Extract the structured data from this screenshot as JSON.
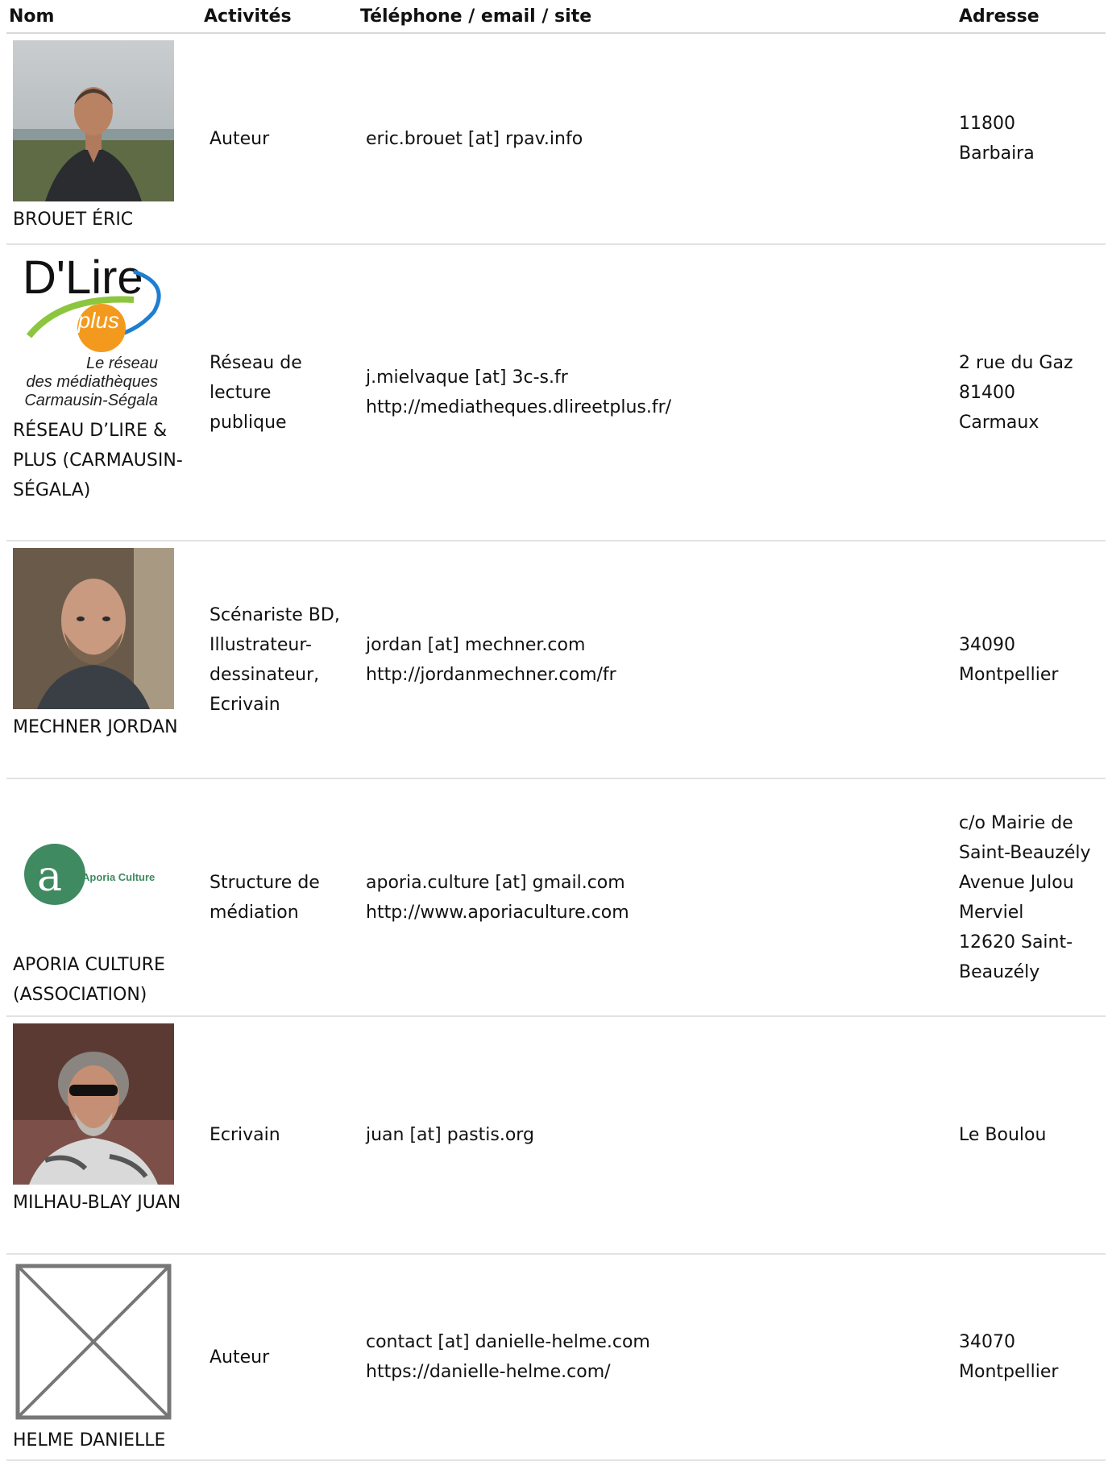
{
  "table": {
    "headers": {
      "name": "Nom",
      "activities": "Activités",
      "contact": "Téléphone / email / site",
      "address": "Adresse"
    },
    "rows": [
      {
        "name": "BROUET ÉRIC",
        "photo_icon": "portrait-photo",
        "activities": "Auteur",
        "contact": [
          "eric.brouet [at] rpav.info"
        ],
        "address": [
          "11800",
          "Barbaira"
        ]
      },
      {
        "name": "RÉSEAU D’LIRE & PLUS (CARMAUSIN-SÉGALA)",
        "photo_icon": "logo-dlire-plus",
        "logo_text": [
          "D'Lire",
          "&plus",
          "Le réseau",
          "des médiathèques",
          "Carmausin-Ségala"
        ],
        "activities": "Réseau de lecture publique",
        "contact": [
          "j.mielvaque [at] 3c-s.fr",
          "http://mediatheques.dlireetplus.fr/"
        ],
        "address": [
          "2 rue du Gaz",
          "81400",
          "Carmaux"
        ]
      },
      {
        "name": "MECHNER JORDAN",
        "photo_icon": "portrait-photo",
        "activities": "Scénariste BD, Illustrateur-dessinateur, Ecrivain",
        "contact": [
          "jordan [at] mechner.com",
          "http://jordanmechner.com/fr"
        ],
        "address": [
          "34090",
          "Montpellier"
        ]
      },
      {
        "name": "APORIA CULTURE (ASSOCIATION)",
        "photo_icon": "logo-aporia-culture",
        "logo_text": [
          "a",
          "Aporia Culture"
        ],
        "activities": "Structure de médiation",
        "contact": [
          "aporia.culture [at] gmail.com",
          "http://www.aporiaculture.com"
        ],
        "address": [
          "c/o Mairie de Saint-Beauzély",
          "Avenue Julou Merviel",
          "12620 Saint-Beauzély"
        ]
      },
      {
        "name": "MILHAU-BLAY JUAN",
        "photo_icon": "portrait-photo",
        "activities": "Ecrivain",
        "contact": [
          "juan [at] pastis.org"
        ],
        "address": [
          "Le Boulou"
        ]
      },
      {
        "name": "HELME DANIELLE",
        "photo_icon": "image-placeholder-icon",
        "activities": "Auteur",
        "contact": [
          "contact [at] danielle-helme.com",
          "https://danielle-helme.com/"
        ],
        "address": [
          "34070",
          "Montpellier"
        ]
      }
    ]
  },
  "colors": {
    "aporia_green": "#3f8a61",
    "dlire_blue": "#1e7fd0",
    "dlire_orange": "#f39a1e",
    "dlire_green": "#8cc63f",
    "border": "#e2e2e2"
  }
}
